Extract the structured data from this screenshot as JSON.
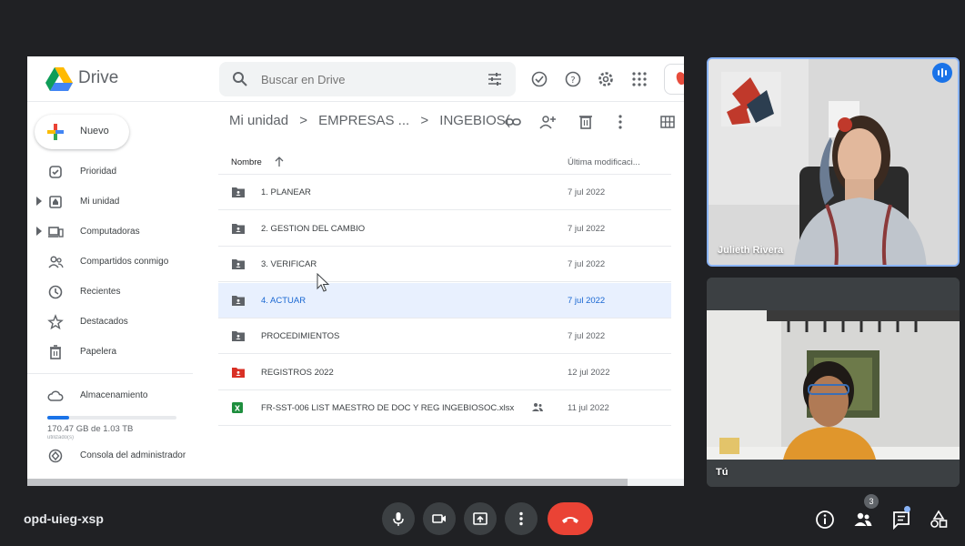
{
  "drive": {
    "brand": "Drive",
    "search_placeholder": "Buscar en Drive",
    "new_label": "Nuevo",
    "nav": [
      {
        "label": "Prioridad",
        "icon": "check-circle-icon"
      },
      {
        "label": "Mi unidad",
        "icon": "my-drive-icon"
      },
      {
        "label": "Computadoras",
        "icon": "computer-icon"
      },
      {
        "label": "Compartidos conmigo",
        "icon": "shared-people-icon"
      },
      {
        "label": "Recientes",
        "icon": "clock-icon"
      },
      {
        "label": "Destacados",
        "icon": "star-icon"
      },
      {
        "label": "Papelera",
        "icon": "trash-icon"
      }
    ],
    "storage": {
      "label": "Almacenamiento",
      "used_text": "170.47 GB de 1.03 TB",
      "used_fraction": 0.17,
      "sub_text": "utilizado(s)"
    },
    "admin_console": "Consola del administrador",
    "breadcrumb": [
      "Mi unidad",
      ">",
      "EMPRESAS ...",
      ">",
      "INGEBIOS("
    ],
    "list_header": {
      "name": "Nombre",
      "modified": "Última modificaci..."
    },
    "files": [
      {
        "name": "1. PLANEAR",
        "date": "7 jul 2022",
        "kind": "shared-folder",
        "selected": false
      },
      {
        "name": "2. GESTION DEL CAMBIO",
        "date": "7 jul 2022",
        "kind": "shared-folder",
        "selected": false
      },
      {
        "name": "3. VERIFICAR",
        "date": "7 jul 2022",
        "kind": "shared-folder",
        "selected": false
      },
      {
        "name": "4. ACTUAR",
        "date": "7 jul 2022",
        "kind": "shared-folder",
        "selected": true
      },
      {
        "name": "PROCEDIMIENTOS",
        "date": "7 jul 2022",
        "kind": "shared-folder",
        "selected": false
      },
      {
        "name": "REGISTROS 2022",
        "date": "12 jul 2022",
        "kind": "red-shared-folder",
        "selected": false
      },
      {
        "name": "FR-SST-006 LIST MAESTRO DE DOC Y REG INGEBIOSOC.xlsx",
        "date": "11 jul 2022",
        "kind": "excel",
        "selected": false
      }
    ]
  },
  "meet": {
    "meeting_code": "opd-uieg-xsp",
    "participants": [
      {
        "name": "Julieth Rivera",
        "speaking": true
      },
      {
        "name": "Tú",
        "speaking": false
      }
    ],
    "people_count": "3"
  },
  "colors": {
    "meet_bg": "#202124",
    "drive_blue": "#1a73e8",
    "hangup_red": "#ea4335",
    "selected_row": "#e8f0fe"
  }
}
